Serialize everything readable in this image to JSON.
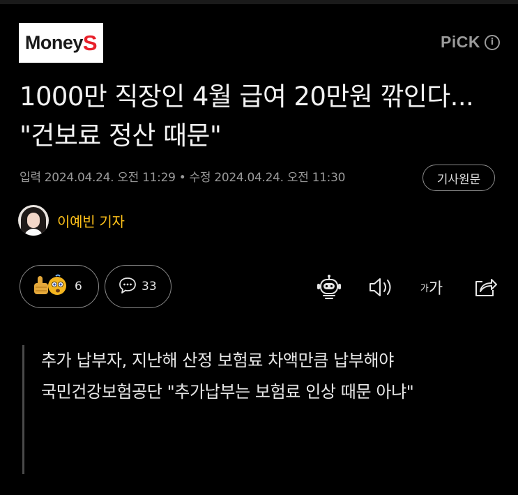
{
  "header": {
    "logo_main": "Money",
    "logo_accent": "S",
    "pick_label": "PiCK",
    "pick_info": "i"
  },
  "article": {
    "headline": "1000만 직장인 4월 급여 20만원 깎인다... \"건보료 정산 때문\"",
    "meta": "입력 2024.04.24. 오전 11:29 • 수정 2024.04.24. 오전 11:30",
    "original_button": "기사원문",
    "author": "이예빈 기자"
  },
  "actions": {
    "reaction_count": "6",
    "comment_count": "33",
    "font_small": "가",
    "font_big": "가"
  },
  "summary": {
    "lines": [
      "추가 납부자, 지난해 산정 보험료 차액만큼 납부해야",
      "국민건강보험공단 \"추가납부는 보험료 인상 때문 아냐\""
    ]
  },
  "icons": {
    "reaction": "reaction-emoji-icon",
    "comment": "comment-icon",
    "bot": "ai-bot-icon",
    "speaker": "speaker-icon",
    "share": "share-icon"
  },
  "colors": {
    "background": "#000000",
    "author_accent": "#ffc21a",
    "logo_red": "#e8202a"
  }
}
